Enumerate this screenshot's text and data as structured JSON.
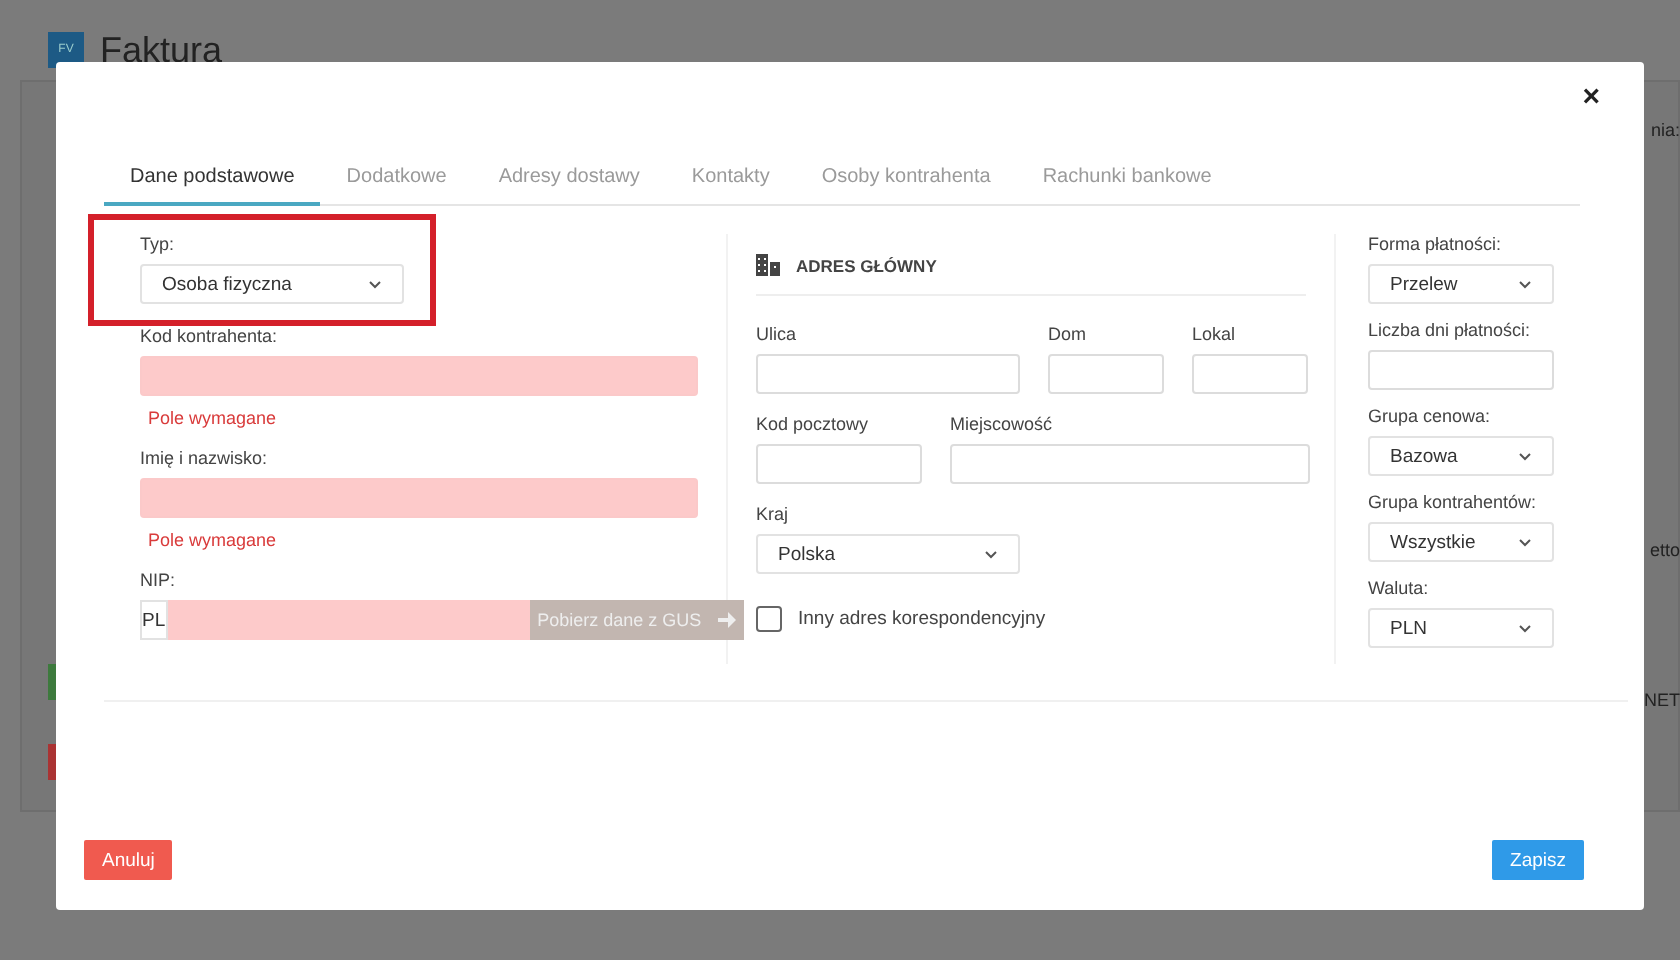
{
  "background": {
    "logo": "FV",
    "title": "Faktura",
    "edge_texts": [
      "nia:",
      "etto",
      "NET"
    ]
  },
  "modal": {
    "close": "×",
    "tabs": [
      {
        "label": "Dane podstawowe",
        "selected": true
      },
      {
        "label": "Dodatkowe",
        "selected": false
      },
      {
        "label": "Adresy dostawy",
        "selected": false
      },
      {
        "label": "Kontakty",
        "selected": false
      },
      {
        "label": "Osoby kontrahenta",
        "selected": false
      },
      {
        "label": "Rachunki bankowe",
        "selected": false
      }
    ],
    "basic": [
      {
        "kind": "select",
        "label": "Typ:",
        "value": "Osoba fizyczna",
        "highlighted": true
      },
      {
        "kind": "input",
        "label": "Kod kontrahenta:",
        "invalid": true,
        "error": "Pole wymagane"
      },
      {
        "kind": "input",
        "label": "Imię i nazwisko:",
        "invalid": true,
        "error": "Pole wymagane"
      },
      {
        "kind": "nip",
        "label": "NIP:",
        "prefix": "PL",
        "invalid": true,
        "button": "Pobierz dane z GUS",
        "button_disabled": true
      }
    ],
    "address": {
      "title": "ADRES GŁÓWNY",
      "rows": [
        [
          {
            "kind": "input",
            "label": "Ulica"
          },
          {
            "kind": "input",
            "label": "Dom"
          },
          {
            "kind": "input",
            "label": "Lokal"
          }
        ],
        [
          {
            "kind": "input",
            "label": "Kod pocztowy"
          },
          {
            "kind": "input",
            "label": "Miejscowość"
          }
        ],
        [
          {
            "kind": "select",
            "label": "Kraj",
            "value": "Polska"
          }
        ]
      ],
      "checkbox": {
        "label": "Inny adres korespondencyjny",
        "checked": false
      }
    },
    "payment": [
      {
        "kind": "select",
        "label": "Forma płatności:",
        "value": "Przelew"
      },
      {
        "kind": "input",
        "label": "Liczba dni płatności:"
      },
      {
        "kind": "select",
        "label": "Grupa cenowa:",
        "value": "Bazowa"
      },
      {
        "kind": "select",
        "label": "Grupa kontrahentów:",
        "value": "Wszystkie"
      },
      {
        "kind": "select",
        "label": "Waluta:",
        "value": "PLN"
      }
    ],
    "buttons": [
      {
        "kind": "cancel",
        "label": "Anuluj"
      },
      {
        "kind": "save",
        "label": "Zapisz"
      }
    ]
  }
}
